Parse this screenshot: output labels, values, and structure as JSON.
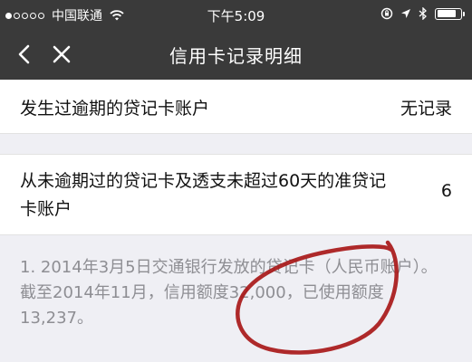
{
  "status_bar": {
    "carrier": "中国联通",
    "time": "下午5:09",
    "signal_bars_filled": 1,
    "signal_bars_total": 5,
    "battery_level": 0.85
  },
  "nav": {
    "title": "信用卡记录明细",
    "back_icon": "chevron-left-icon",
    "close_icon": "close-icon"
  },
  "rows": [
    {
      "label": "发生过逾期的贷记卡账户",
      "value": "无记录"
    },
    {
      "label": "从未逾期过的贷记卡及透支未超过60天的准贷记卡账户",
      "value": "6"
    }
  ],
  "detail": {
    "text": "1. 2014年3月5日交通银行发放的贷记卡（人民币账户）。截至2014年11月，信用额度32,000，已使用额度13,237。"
  },
  "colors": {
    "header_bg": "#3a3a3a",
    "section_bg": "#efeff4",
    "detail_text": "#8e8e93",
    "annotation": "#a81818"
  }
}
